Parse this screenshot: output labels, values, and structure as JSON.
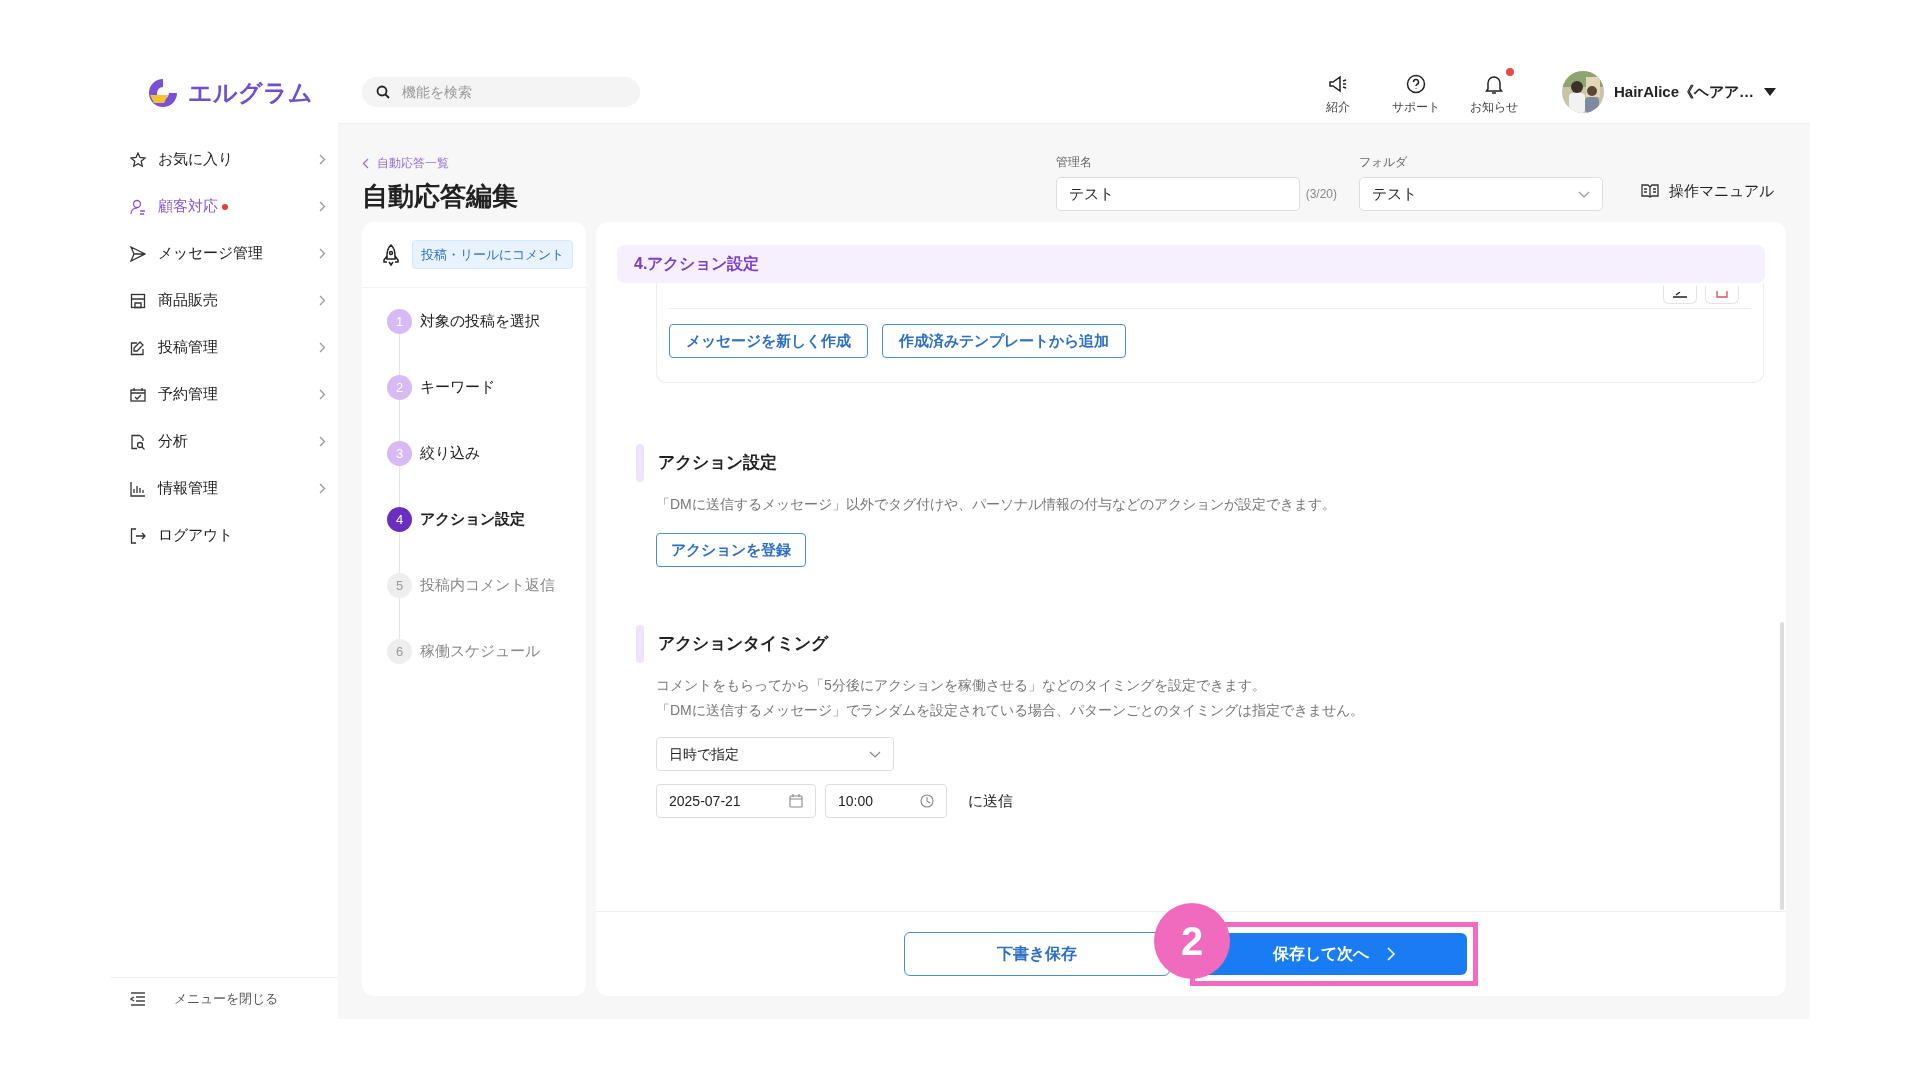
{
  "logo": {
    "text": "エルグラム"
  },
  "sidebar": {
    "items": [
      {
        "label": "お気に入り",
        "kind": "menu",
        "selected": false,
        "dot": false
      },
      {
        "label": "顧客対応",
        "kind": "menu",
        "selected": true,
        "dot": true
      },
      {
        "label": "メッセージ管理",
        "kind": "menu",
        "selected": false,
        "dot": false
      },
      {
        "label": "商品販売",
        "kind": "menu",
        "selected": false,
        "dot": false
      },
      {
        "label": "投稿管理",
        "kind": "menu",
        "selected": false,
        "dot": false
      },
      {
        "label": "予約管理",
        "kind": "menu",
        "selected": false,
        "dot": false
      },
      {
        "label": "分析",
        "kind": "menu",
        "selected": false,
        "dot": false
      },
      {
        "label": "情報管理",
        "kind": "menu",
        "selected": false,
        "dot": false
      },
      {
        "label": "ログアウト",
        "kind": "action",
        "selected": false,
        "dot": false
      }
    ],
    "collapse": "メニューを閉じる"
  },
  "header": {
    "search": {
      "placeholder": "機能を検索"
    },
    "nav": [
      {
        "label": "紹介",
        "unread": false
      },
      {
        "label": "サポート",
        "unread": false
      },
      {
        "label": "お知らせ",
        "unread": true
      }
    ],
    "user": "HairAlice《ヘアア…"
  },
  "page": {
    "breadcrumb": "自動応答一覧",
    "title": "自動応答編集",
    "name_field": {
      "label": "管理名",
      "value": "テスト",
      "counter": "(3/20)"
    },
    "folder_field": {
      "label": "フォルダ",
      "value": "テスト"
    },
    "manual": "操作マニュアル"
  },
  "steps": {
    "trigger": "投稿・リールにコメント",
    "items": [
      {
        "number": "1",
        "label": "対象の投稿を選択",
        "completed": true,
        "selected": false
      },
      {
        "number": "2",
        "label": "キーワード",
        "completed": true,
        "selected": false
      },
      {
        "number": "3",
        "label": "絞り込み",
        "completed": true,
        "selected": false
      },
      {
        "number": "4",
        "label": "アクション設定",
        "completed": false,
        "selected": true
      },
      {
        "number": "5",
        "label": "投稿内コメント返信",
        "completed": false,
        "selected": false
      },
      {
        "number": "6",
        "label": "稼働スケジュール",
        "completed": false,
        "selected": false
      }
    ]
  },
  "main": {
    "section_header": "4.アクション設定",
    "message_buttons": [
      "メッセージを新しく作成",
      "作成済みテンプレートから追加"
    ],
    "action": {
      "title": "アクション設定",
      "description": "「DMに送信するメッセージ」以外でタグ付けや、パーソナル情報の付与などのアクションが設定できます。",
      "button": "アクションを登録"
    },
    "timing": {
      "title": "アクションタイミング",
      "description": [
        "コメントをもらってから「5分後にアクションを稼働させる」などのタイミングを設定できます。",
        "「DMに送信するメッセージ」でランダムを設定されている場合、パターンごとのタイミングは指定できません。"
      ],
      "mode": "日時で指定",
      "date": "2025-07-21",
      "time": "10:00",
      "suffix": "に送信"
    }
  },
  "footer": {
    "draft": "下書き保存",
    "next": "保存して次へ",
    "callout": "2"
  }
}
